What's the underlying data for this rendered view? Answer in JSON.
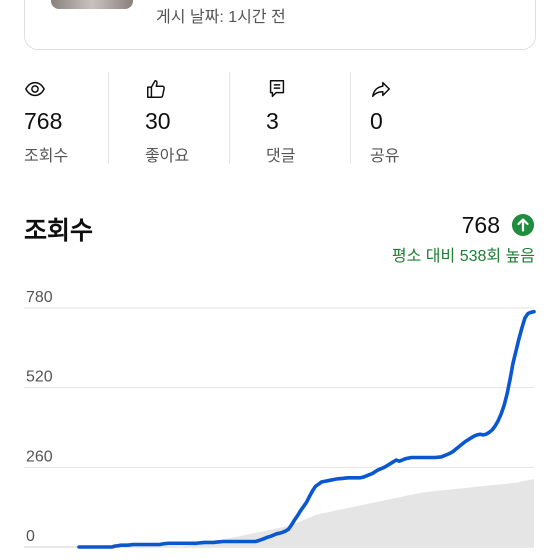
{
  "post": {
    "date_label": "게시 날짜: 1시간 전"
  },
  "stats": [
    {
      "icon": "eye-icon",
      "value": "768",
      "label": "조회수"
    },
    {
      "icon": "thumbs-up-icon",
      "value": "30",
      "label": "좋아요"
    },
    {
      "icon": "comment-icon",
      "value": "3",
      "label": "댓글"
    },
    {
      "icon": "share-icon",
      "value": "0",
      "label": "공유"
    }
  ],
  "views_section": {
    "title": "조회수",
    "count": "768",
    "trend_icon": "arrow-up-icon",
    "comparison": "평소 대비 538회 높음",
    "colors": {
      "accent_line": "#0b57d0",
      "baseline_area": "#e5e5e5",
      "positive": "#1e8e3e"
    }
  },
  "chart_data": {
    "type": "area",
    "title": "",
    "xlabel": "",
    "ylabel": "",
    "ylim": [
      0,
      780
    ],
    "y_ticks": [
      "780",
      "520",
      "260",
      "0"
    ],
    "grid": true,
    "series": [
      {
        "values": [
          0,
          0,
          0,
          0,
          0,
          0,
          0,
          0,
          0,
          0,
          0,
          0,
          3,
          4,
          6,
          6,
          6,
          7,
          8,
          8,
          8,
          8,
          8,
          8,
          8,
          8,
          8,
          8,
          10,
          11,
          12,
          12,
          12,
          12,
          12,
          12,
          12,
          12,
          12,
          12,
          13,
          14,
          15,
          15,
          15,
          15,
          16,
          17,
          18,
          18,
          18,
          18,
          18,
          18,
          18,
          18,
          18,
          18,
          18,
          18,
          21,
          24,
          28,
          32,
          35,
          39,
          43,
          45,
          48,
          52,
          58,
          72,
          88,
          102,
          118,
          132,
          146,
          165,
          183,
          198,
          205,
          212,
          214,
          216,
          218,
          220,
          222,
          223,
          224,
          225,
          226,
          226,
          226,
          226,
          226,
          228,
          232,
          236,
          240,
          246,
          252,
          256,
          260,
          266,
          272,
          278,
          284,
          280,
          284,
          288,
          290,
          292,
          292,
          292,
          292,
          292,
          292,
          292,
          292,
          292,
          293,
          294,
          298,
          302,
          306,
          312,
          320,
          328,
          336,
          344,
          350,
          356,
          362,
          366,
          368,
          366,
          368,
          374,
          382,
          395,
          412,
          434,
          462,
          500,
          548,
          600,
          640,
          680,
          716,
          748,
          762,
          766,
          768
        ]
      },
      {
        "values": [
          0,
          0,
          0,
          0,
          0,
          0,
          0,
          0,
          0,
          0,
          0,
          0,
          0,
          0,
          0,
          0,
          0,
          0,
          0,
          0,
          0,
          0,
          0,
          0,
          0,
          0,
          0,
          0,
          0,
          0,
          0,
          0,
          0,
          0,
          1,
          2,
          3,
          4,
          5,
          6,
          7,
          8,
          10,
          12,
          14,
          16,
          18,
          20,
          22,
          24,
          26,
          28,
          30,
          32,
          34,
          36,
          38,
          40,
          42,
          44,
          46,
          48,
          50,
          52,
          54,
          56,
          58,
          60,
          62,
          64,
          66,
          68,
          70,
          74,
          78,
          82,
          86,
          90,
          94,
          98,
          102,
          106,
          108,
          110,
          112,
          114,
          116,
          118,
          120,
          122,
          124,
          126,
          128,
          130,
          132,
          134,
          136,
          138,
          140,
          142,
          144,
          146,
          148,
          150,
          152,
          154,
          156,
          158,
          160,
          162,
          164,
          166,
          168,
          170,
          172,
          174,
          176,
          178,
          179,
          180,
          181,
          182,
          183,
          184,
          185,
          186,
          187,
          188,
          189,
          190,
          191,
          192,
          193,
          194,
          195,
          196,
          197,
          198,
          199,
          200,
          201,
          202,
          203,
          204,
          205,
          206,
          207,
          208,
          209,
          210,
          212,
          214,
          216,
          218,
          220,
          222
        ]
      }
    ]
  }
}
